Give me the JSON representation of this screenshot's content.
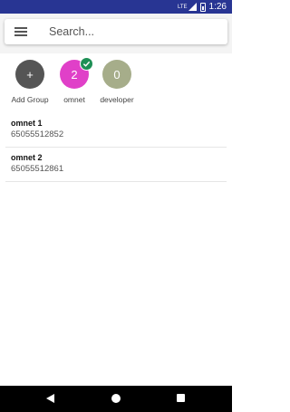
{
  "status_bar": {
    "time": "1:26",
    "network_label": "LTE",
    "background_color": "#283593"
  },
  "search": {
    "placeholder": "Search...",
    "value": ""
  },
  "groups": [
    {
      "label": "Add Group",
      "avatar_text": "+",
      "color": "#555555",
      "selected": false
    },
    {
      "label": "omnet",
      "avatar_text": "2",
      "color": "#e040c8",
      "selected": true
    },
    {
      "label": "developer",
      "avatar_text": "0",
      "color": "#a6ad8a",
      "selected": false
    }
  ],
  "contacts": [
    {
      "name": "omnet 1",
      "phone": "65055512852"
    },
    {
      "name": "omnet 2",
      "phone": "65055512861"
    }
  ]
}
